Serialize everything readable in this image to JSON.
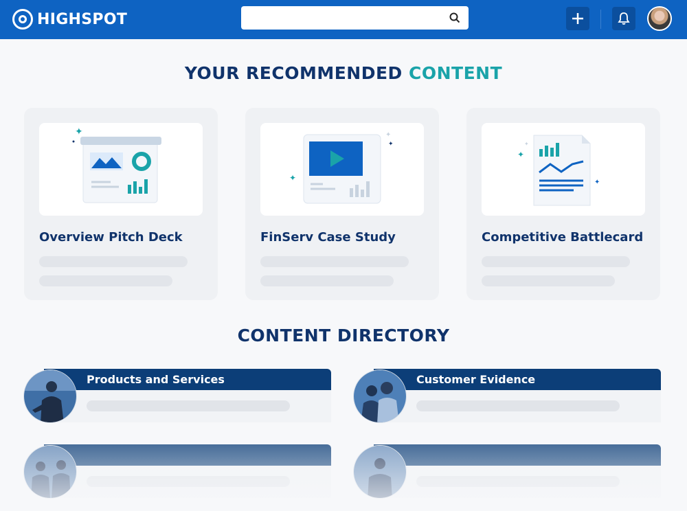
{
  "brand": {
    "name": "HIGHSPOT"
  },
  "header": {
    "search_placeholder": "",
    "icons": [
      "search-icon",
      "plus-icon",
      "bell-icon",
      "user-avatar"
    ]
  },
  "recommended": {
    "title_main": "YOUR RECOMMENDED",
    "title_accent": "CONTENT",
    "cards": [
      {
        "title": "Overview Pitch Deck",
        "icon": "presentation-icon"
      },
      {
        "title": "FinServ Case Study",
        "icon": "video-play-icon"
      },
      {
        "title": "Competitive Battlecard",
        "icon": "report-document-icon"
      }
    ]
  },
  "directory": {
    "title": "CONTENT DIRECTORY",
    "items": [
      {
        "label": "Products and Services"
      },
      {
        "label": "Customer Evidence"
      },
      {
        "label": ""
      },
      {
        "label": ""
      }
    ]
  },
  "colors": {
    "primary": "#0e63c2",
    "navy": "#10336b",
    "teal": "#1aa3a9",
    "band": "#0c3e78"
  }
}
